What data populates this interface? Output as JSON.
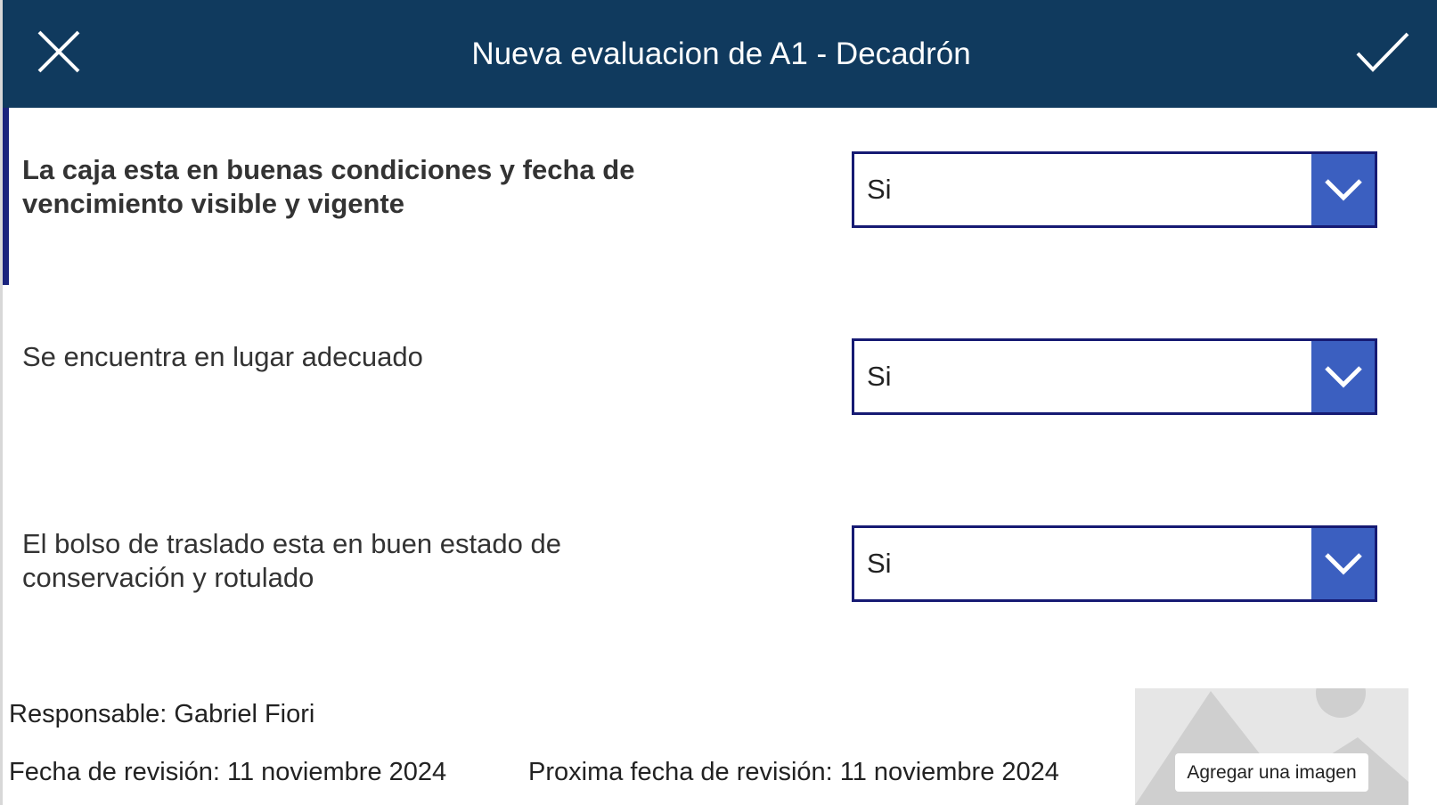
{
  "header": {
    "title": "Nueva evaluacion de A1 - Decadrón",
    "close_icon": "close-icon",
    "confirm_icon": "checkmark-icon",
    "background_color": "#103a5e"
  },
  "questions": [
    {
      "label": "La caja esta en buenas condiciones y fecha de vencimiento visible y vigente",
      "selected": "Si"
    },
    {
      "label": "Se encuentra en lugar adecuado",
      "selected": "Si"
    },
    {
      "label": "El bolso de traslado esta en buen estado de conservación y rotulado",
      "selected": "Si"
    }
  ],
  "footer": {
    "responsable": "Responsable: Gabriel Fiori",
    "fecha_revision": "Fecha de revisión: 11 noviembre 2024",
    "proxima_fecha": "Proxima fecha de revisión: 11 noviembre 2024"
  },
  "image_picker": {
    "button_label": "Agregar una imagen",
    "placeholder_icon": "image-placeholder-icon"
  },
  "colors": {
    "dropdown_border": "#161a73",
    "dropdown_chevron_bg": "#3b5fc0",
    "focus_indicator": "#1a237e"
  }
}
